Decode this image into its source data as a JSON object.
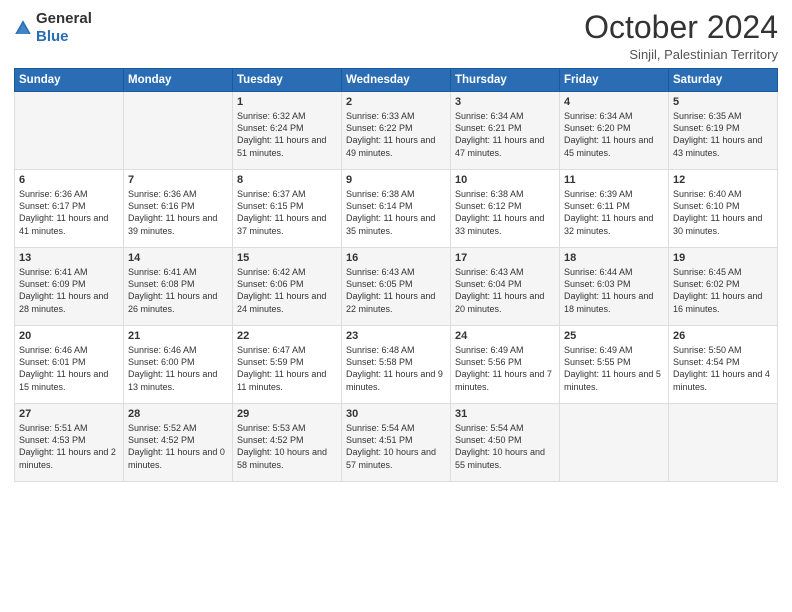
{
  "header": {
    "logo_general": "General",
    "logo_blue": "Blue",
    "month_title": "October 2024",
    "location": "Sinjil, Palestinian Territory"
  },
  "days_of_week": [
    "Sunday",
    "Monday",
    "Tuesday",
    "Wednesday",
    "Thursday",
    "Friday",
    "Saturday"
  ],
  "weeks": [
    [
      {
        "day": "",
        "sunrise": "",
        "sunset": "",
        "daylight": ""
      },
      {
        "day": "",
        "sunrise": "",
        "sunset": "",
        "daylight": ""
      },
      {
        "day": "1",
        "sunrise": "Sunrise: 6:32 AM",
        "sunset": "Sunset: 6:24 PM",
        "daylight": "Daylight: 11 hours and 51 minutes."
      },
      {
        "day": "2",
        "sunrise": "Sunrise: 6:33 AM",
        "sunset": "Sunset: 6:22 PM",
        "daylight": "Daylight: 11 hours and 49 minutes."
      },
      {
        "day": "3",
        "sunrise": "Sunrise: 6:34 AM",
        "sunset": "Sunset: 6:21 PM",
        "daylight": "Daylight: 11 hours and 47 minutes."
      },
      {
        "day": "4",
        "sunrise": "Sunrise: 6:34 AM",
        "sunset": "Sunset: 6:20 PM",
        "daylight": "Daylight: 11 hours and 45 minutes."
      },
      {
        "day": "5",
        "sunrise": "Sunrise: 6:35 AM",
        "sunset": "Sunset: 6:19 PM",
        "daylight": "Daylight: 11 hours and 43 minutes."
      }
    ],
    [
      {
        "day": "6",
        "sunrise": "Sunrise: 6:36 AM",
        "sunset": "Sunset: 6:17 PM",
        "daylight": "Daylight: 11 hours and 41 minutes."
      },
      {
        "day": "7",
        "sunrise": "Sunrise: 6:36 AM",
        "sunset": "Sunset: 6:16 PM",
        "daylight": "Daylight: 11 hours and 39 minutes."
      },
      {
        "day": "8",
        "sunrise": "Sunrise: 6:37 AM",
        "sunset": "Sunset: 6:15 PM",
        "daylight": "Daylight: 11 hours and 37 minutes."
      },
      {
        "day": "9",
        "sunrise": "Sunrise: 6:38 AM",
        "sunset": "Sunset: 6:14 PM",
        "daylight": "Daylight: 11 hours and 35 minutes."
      },
      {
        "day": "10",
        "sunrise": "Sunrise: 6:38 AM",
        "sunset": "Sunset: 6:12 PM",
        "daylight": "Daylight: 11 hours and 33 minutes."
      },
      {
        "day": "11",
        "sunrise": "Sunrise: 6:39 AM",
        "sunset": "Sunset: 6:11 PM",
        "daylight": "Daylight: 11 hours and 32 minutes."
      },
      {
        "day": "12",
        "sunrise": "Sunrise: 6:40 AM",
        "sunset": "Sunset: 6:10 PM",
        "daylight": "Daylight: 11 hours and 30 minutes."
      }
    ],
    [
      {
        "day": "13",
        "sunrise": "Sunrise: 6:41 AM",
        "sunset": "Sunset: 6:09 PM",
        "daylight": "Daylight: 11 hours and 28 minutes."
      },
      {
        "day": "14",
        "sunrise": "Sunrise: 6:41 AM",
        "sunset": "Sunset: 6:08 PM",
        "daylight": "Daylight: 11 hours and 26 minutes."
      },
      {
        "day": "15",
        "sunrise": "Sunrise: 6:42 AM",
        "sunset": "Sunset: 6:06 PM",
        "daylight": "Daylight: 11 hours and 24 minutes."
      },
      {
        "day": "16",
        "sunrise": "Sunrise: 6:43 AM",
        "sunset": "Sunset: 6:05 PM",
        "daylight": "Daylight: 11 hours and 22 minutes."
      },
      {
        "day": "17",
        "sunrise": "Sunrise: 6:43 AM",
        "sunset": "Sunset: 6:04 PM",
        "daylight": "Daylight: 11 hours and 20 minutes."
      },
      {
        "day": "18",
        "sunrise": "Sunrise: 6:44 AM",
        "sunset": "Sunset: 6:03 PM",
        "daylight": "Daylight: 11 hours and 18 minutes."
      },
      {
        "day": "19",
        "sunrise": "Sunrise: 6:45 AM",
        "sunset": "Sunset: 6:02 PM",
        "daylight": "Daylight: 11 hours and 16 minutes."
      }
    ],
    [
      {
        "day": "20",
        "sunrise": "Sunrise: 6:46 AM",
        "sunset": "Sunset: 6:01 PM",
        "daylight": "Daylight: 11 hours and 15 minutes."
      },
      {
        "day": "21",
        "sunrise": "Sunrise: 6:46 AM",
        "sunset": "Sunset: 6:00 PM",
        "daylight": "Daylight: 11 hours and 13 minutes."
      },
      {
        "day": "22",
        "sunrise": "Sunrise: 6:47 AM",
        "sunset": "Sunset: 5:59 PM",
        "daylight": "Daylight: 11 hours and 11 minutes."
      },
      {
        "day": "23",
        "sunrise": "Sunrise: 6:48 AM",
        "sunset": "Sunset: 5:58 PM",
        "daylight": "Daylight: 11 hours and 9 minutes."
      },
      {
        "day": "24",
        "sunrise": "Sunrise: 6:49 AM",
        "sunset": "Sunset: 5:56 PM",
        "daylight": "Daylight: 11 hours and 7 minutes."
      },
      {
        "day": "25",
        "sunrise": "Sunrise: 6:49 AM",
        "sunset": "Sunset: 5:55 PM",
        "daylight": "Daylight: 11 hours and 5 minutes."
      },
      {
        "day": "26",
        "sunrise": "Sunrise: 5:50 AM",
        "sunset": "Sunset: 4:54 PM",
        "daylight": "Daylight: 11 hours and 4 minutes."
      }
    ],
    [
      {
        "day": "27",
        "sunrise": "Sunrise: 5:51 AM",
        "sunset": "Sunset: 4:53 PM",
        "daylight": "Daylight: 11 hours and 2 minutes."
      },
      {
        "day": "28",
        "sunrise": "Sunrise: 5:52 AM",
        "sunset": "Sunset: 4:52 PM",
        "daylight": "Daylight: 11 hours and 0 minutes."
      },
      {
        "day": "29",
        "sunrise": "Sunrise: 5:53 AM",
        "sunset": "Sunset: 4:52 PM",
        "daylight": "Daylight: 10 hours and 58 minutes."
      },
      {
        "day": "30",
        "sunrise": "Sunrise: 5:54 AM",
        "sunset": "Sunset: 4:51 PM",
        "daylight": "Daylight: 10 hours and 57 minutes."
      },
      {
        "day": "31",
        "sunrise": "Sunrise: 5:54 AM",
        "sunset": "Sunset: 4:50 PM",
        "daylight": "Daylight: 10 hours and 55 minutes."
      },
      {
        "day": "",
        "sunrise": "",
        "sunset": "",
        "daylight": ""
      },
      {
        "day": "",
        "sunrise": "",
        "sunset": "",
        "daylight": ""
      }
    ]
  ]
}
